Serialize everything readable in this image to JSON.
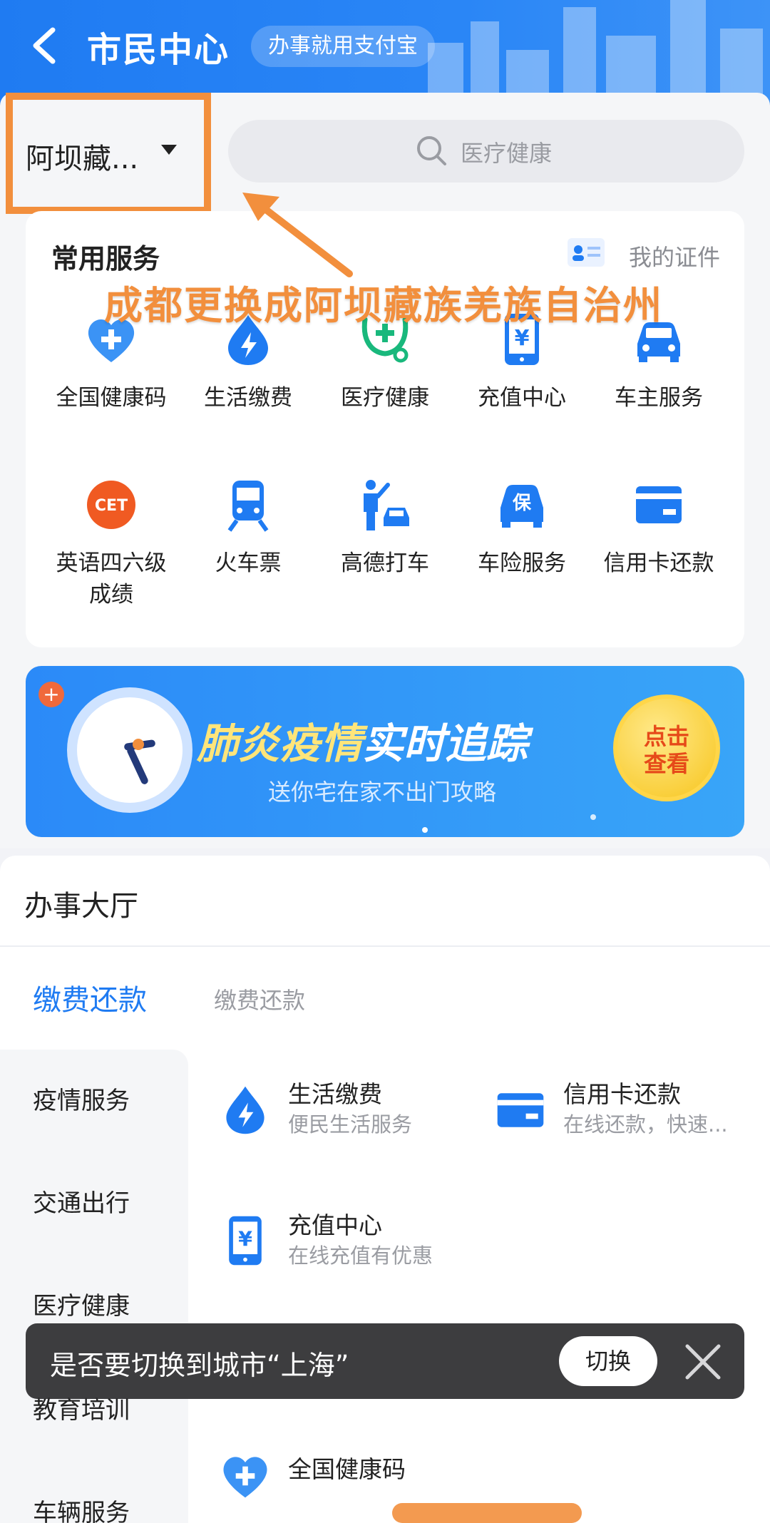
{
  "header": {
    "title": "市民中心",
    "tagline": "办事就用支付宝"
  },
  "location": {
    "city": "阿坝藏..."
  },
  "search": {
    "placeholder": "医疗健康"
  },
  "common_services": {
    "title": "常用服务",
    "my_certificates": "我的证件",
    "items": [
      {
        "label": "全国健康码",
        "icon": "health-code-heart-icon"
      },
      {
        "label": "生活缴费",
        "icon": "utility-bolt-drop-icon"
      },
      {
        "label": "医疗健康",
        "icon": "medical-stethoscope-icon"
      },
      {
        "label": "充值中心",
        "icon": "phone-yen-icon"
      },
      {
        "label": "车主服务",
        "icon": "car-icon"
      },
      {
        "label": "英语四六级成绩",
        "icon": "cet-icon"
      },
      {
        "label": "火车票",
        "icon": "train-icon"
      },
      {
        "label": "高德打车",
        "icon": "taxi-hail-icon"
      },
      {
        "label": "车险服务",
        "icon": "car-insurance-icon"
      },
      {
        "label": "信用卡还款",
        "icon": "credit-card-icon"
      }
    ]
  },
  "annotation": {
    "text": "成都更换成阿坝藏族羌族自治州",
    "color": "#f28f3d"
  },
  "banner": {
    "headline_part1": "肺炎疫情",
    "headline_part2": "实时追踪",
    "subtitle": "送你宅在家不出门攻略",
    "cta_line1": "点击",
    "cta_line2": "查看"
  },
  "hall": {
    "title": "办事大厅",
    "active_tab": "缴费还款",
    "sub_tab": "缴费还款",
    "sidebar": [
      "疫情服务",
      "交通出行",
      "医疗健康",
      "教育培训",
      "车辆服务"
    ],
    "items": [
      {
        "title": "生活缴费",
        "subtitle": "便民生活服务",
        "icon": "utility-bolt-drop-icon"
      },
      {
        "title": "信用卡还款",
        "subtitle": "在线还款，快速...",
        "icon": "credit-card-icon"
      },
      {
        "title": "充值中心",
        "subtitle": "在线充值有优惠",
        "icon": "phone-yen-icon"
      },
      {
        "title": "全国健康码",
        "subtitle": "",
        "icon": "health-code-heart-icon"
      }
    ]
  },
  "toast": {
    "message": "是否要切换到城市“上海”",
    "switch_label": "切换"
  },
  "colors": {
    "brand_blue": "#1f7bf2",
    "annotation_orange": "#f28f3d"
  }
}
